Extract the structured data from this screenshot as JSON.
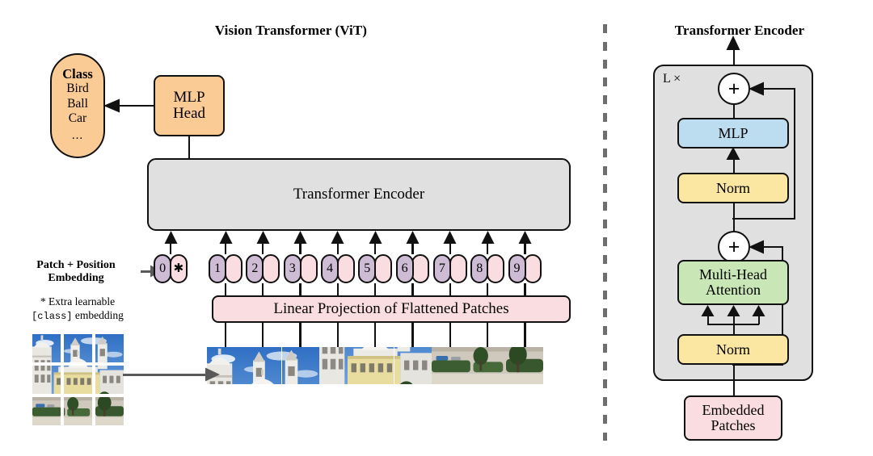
{
  "figure": {
    "left_title": "Vision Transformer (ViT)",
    "right_title": "Transformer Encoder"
  },
  "left_panel": {
    "class_head": {
      "heading": "Class",
      "items": [
        "Bird",
        "Ball",
        "Car"
      ],
      "ellipsis": "..."
    },
    "mlp_head": {
      "line1": "MLP",
      "line2": "Head"
    },
    "encoder_box_label": "Transformer Encoder",
    "linear_projection_label": "Linear Projection of Flattened Patches",
    "patch_position_embedding_label_line1": "Patch + Position",
    "patch_position_embedding_label_line2": "Embedding",
    "footnote_line1": "* Extra learnable",
    "footnote_mono": "[class]",
    "footnote_line2_tail": " embedding",
    "tokens": [
      {
        "pos": "0",
        "emb": "✱",
        "is_class": true
      },
      {
        "pos": "1",
        "emb": ""
      },
      {
        "pos": "2",
        "emb": ""
      },
      {
        "pos": "3",
        "emb": ""
      },
      {
        "pos": "4",
        "emb": ""
      },
      {
        "pos": "5",
        "emb": ""
      },
      {
        "pos": "6",
        "emb": ""
      },
      {
        "pos": "7",
        "emb": ""
      },
      {
        "pos": "8",
        "emb": ""
      },
      {
        "pos": "9",
        "emb": ""
      }
    ],
    "patch_count": 9,
    "source_grid_rows": 3,
    "source_grid_cols": 3
  },
  "right_panel": {
    "repeat_label": "L ×",
    "blocks": {
      "mlp": "MLP",
      "norm_top": "Norm",
      "attention_line1": "Multi-Head",
      "attention_line2": "Attention",
      "norm_bottom": "Norm",
      "embedded_patches_line1": "Embedded",
      "embedded_patches_line2": "Patches"
    },
    "residual_add_symbol": "+"
  },
  "colors": {
    "orange": "#fbcb96",
    "pink": "#fadde0",
    "purple": "#cdbcd4",
    "gray_box": "#e0e0e0",
    "blue": "#bcdcef",
    "yellow": "#fbe6a2",
    "green": "#c9e7b6",
    "outline": "#111111",
    "divider_gray": "#6e6e6e",
    "background": "#ffffff"
  }
}
